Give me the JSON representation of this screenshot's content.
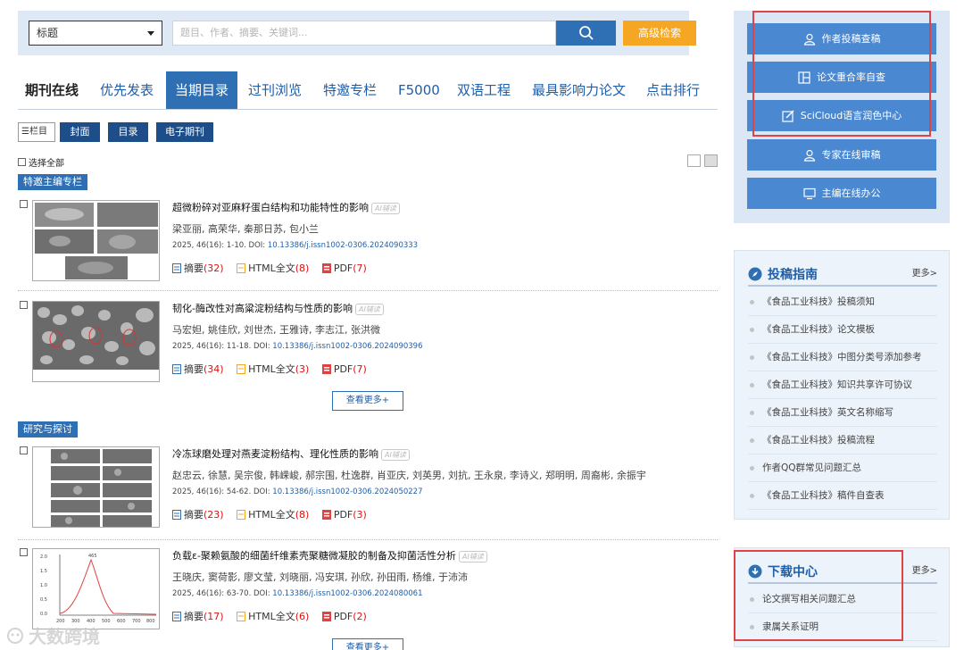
{
  "search": {
    "field_select": "标题",
    "placeholder": "题目、作者、摘要、关键词...",
    "advanced_label": "高级检索"
  },
  "nav": {
    "brand": "期刊在线",
    "items": [
      "优先发表",
      "当期目录",
      "过刊浏览",
      "特邀专栏",
      "F5000",
      "双语工程",
      "最具影响力论文",
      "点击排行"
    ],
    "active": "当期目录"
  },
  "toolbar": {
    "column_view_label": "栏目",
    "cover_label": "封面",
    "toc_label": "目录",
    "ejournal_label": "电子期刊",
    "select_all_label": "选择全部"
  },
  "sections": [
    {
      "label": "特邀主编专栏"
    },
    {
      "label": "研究与探讨"
    }
  ],
  "more_label": "查看更多+",
  "ai_label": "AI辅读",
  "link_labels": {
    "abstract": "摘要",
    "html": "HTML全文",
    "pdf": "PDF"
  },
  "articles": [
    {
      "title": "超微粉碎对亚麻籽蛋白结构和功能特性的影响",
      "authors": "梁亚丽, 高荣华, 秦那日苏, 包小兰",
      "cite": "2025, 46(16): 1-10. DOI: ",
      "doi": "10.13386/j.issn1002-0306.2024090333",
      "abstract_count": "(32)",
      "html_count": "(8)",
      "pdf_count": "(7)"
    },
    {
      "title": "韧化-酶改性对高粱淀粉结构与性质的影响",
      "authors": "马宏妲, 姚佳欣, 刘世杰, 王雅诗, 李志江, 张洪微",
      "cite": "2025, 46(16): 11-18. DOI: ",
      "doi": "10.13386/j.issn1002-0306.2024090396",
      "abstract_count": "(34)",
      "html_count": "(3)",
      "pdf_count": "(7)"
    },
    {
      "title": "冷冻球磨处理对燕麦淀粉结构、理化性质的影响",
      "authors": "赵忠云, 徐慧, 吴宗俊, 韩嵘峻, 郝宗围, 杜逸群, 肖亚庆, 刘英男, 刘抗, 王永泉, 李诗义, 郑明明, 周裔彬, 余振宇",
      "cite": "2025, 46(16): 54-62. DOI: ",
      "doi": "10.13386/j.issn1002-0306.2024050227",
      "abstract_count": "(23)",
      "html_count": "(8)",
      "pdf_count": "(3)"
    },
    {
      "title": "负载ε-聚赖氨酸的细菌纤维素壳聚糖微凝胶的制备及抑菌活性分析",
      "authors": "王晓庆, 窦荷影, 廖文莹, 刘晓丽, 冯安琪, 孙欣, 孙田雨, 杨维, 于沛沛",
      "cite": "2025, 46(16): 63-70. DOI: ",
      "doi": "10.13386/j.issn1002-0306.2024080061",
      "abstract_count": "(17)",
      "html_count": "(6)",
      "pdf_count": "(2)"
    }
  ],
  "side": {
    "buttons": [
      "作者投稿查稿",
      "论文重合率自查",
      "SciCloud语言润色中心",
      "专家在线审稿",
      "主编在线办公"
    ],
    "guide": {
      "title": "投稿指南",
      "more": "更多>",
      "items": [
        "《食品工业科技》投稿须知",
        "《食品工业科技》论文模板",
        "《食品工业科技》中图分类号添加参考",
        "《食品工业科技》知识共享许可协议",
        "《食品工业科技》英文名称缩写",
        "《食品工业科技》投稿流程",
        "作者QQ群常见问题汇总",
        "《食品工业科技》稿件自查表"
      ]
    },
    "download": {
      "title": "下载中心",
      "more": "更多>",
      "items": [
        "论文撰写相关问题汇总",
        "隶属关系证明"
      ]
    }
  },
  "watermark": "大数跨境",
  "chart_thumb": {
    "y_ticks": [
      "2.0",
      "1.5",
      "1.0",
      "0.5",
      "0.0"
    ],
    "x_ticks": [
      "200",
      "300",
      "400",
      "500",
      "600",
      "700",
      "800"
    ],
    "peak_label": "465"
  }
}
